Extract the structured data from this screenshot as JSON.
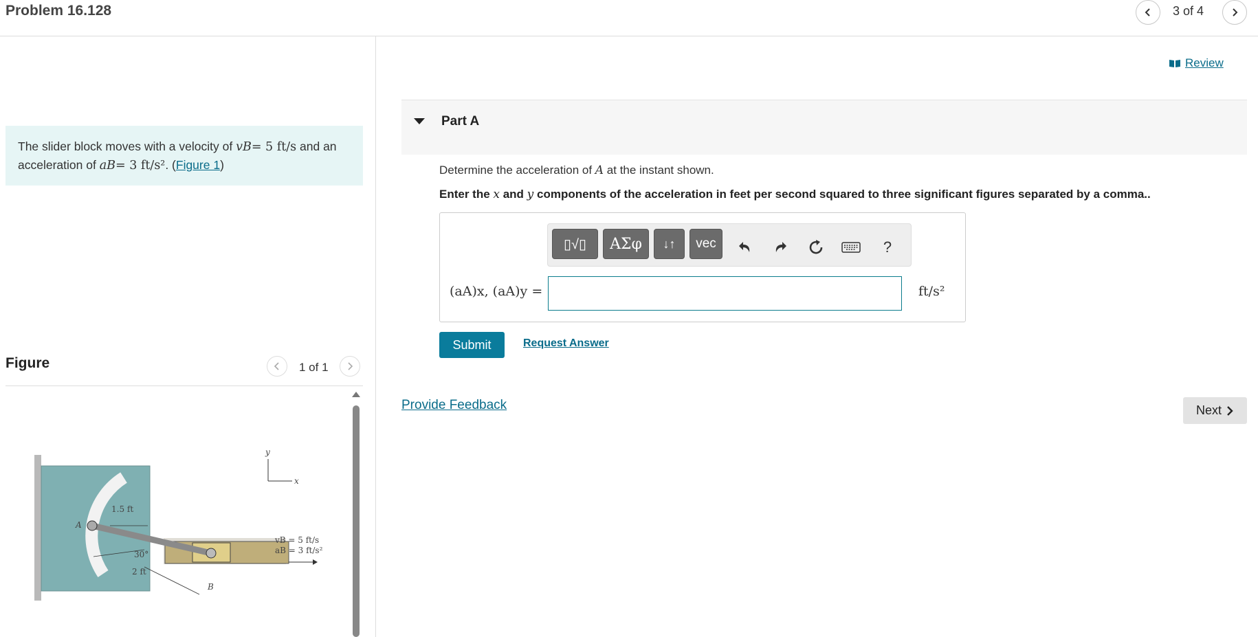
{
  "header": {
    "title": "Problem 16.128",
    "pager": "3 of 4"
  },
  "problem": {
    "text_before": "The slider block moves with a velocity of ",
    "vb_var": "vB",
    "vb_value": "= 5 ft/s",
    "text_mid": " and an acceleration of ",
    "ab_var": "aB",
    "ab_value": "= 3 ft/s²",
    "text_after": ". (",
    "figure_link": "Figure 1",
    "text_close": ")"
  },
  "figure": {
    "label": "Figure",
    "pager": "1 of 1",
    "diagram": {
      "y_axis": "y",
      "x_axis": "x",
      "radius_label": "1.5 ft",
      "point_a": "A",
      "point_b": "B",
      "angle": "30°",
      "length": "2 ft",
      "vb": "vB = 5 ft/s",
      "ab": "aB = 3 ft/s²"
    }
  },
  "review": {
    "label": "Review"
  },
  "part_a": {
    "title": "Part A",
    "question_prefix": "Determine the acceleration of ",
    "question_var": "A",
    "question_suffix": " at the instant shown.",
    "instruction": {
      "prefix": "Enter the ",
      "x": "x",
      "and": " and ",
      "y": "y",
      "suffix": " components of the acceleration in feet per second squared to three significant figures separated by a comma.."
    },
    "toolbar": {
      "templates": "▯√▯",
      "greek": "ΑΣφ",
      "arrows": "↓↑",
      "vec": "vec",
      "help": "?"
    },
    "equation_label": "(aA)x, (aA)y =",
    "input_value": "",
    "unit": "ft/s²",
    "submit": "Submit",
    "request_answer": "Request Answer"
  },
  "footer": {
    "feedback": "Provide Feedback",
    "next": "Next"
  }
}
